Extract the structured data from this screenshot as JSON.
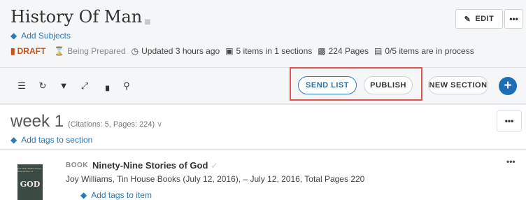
{
  "header": {
    "title": "History Of Man",
    "edit_label": "EDIT",
    "more_label": "•••",
    "add_subjects": "Add Subjects",
    "status": {
      "draft": "DRAFT",
      "prepared": "Being Prepared",
      "updated": "Updated 3 hours ago",
      "items_sections": "5 items in 1 sections",
      "pages": "224 Pages",
      "in_process": "0/5 items are in process"
    }
  },
  "toolbar": {
    "send_list": "SEND LIST",
    "publish": "PUBLISH",
    "new_section": "NEW SECTION",
    "add_label": "+"
  },
  "section": {
    "name": "week 1",
    "meta": "(Citations: 5, Pages: 224)",
    "add_tags": "Add tags to section",
    "more_label": "•••"
  },
  "item": {
    "type": "BOOK",
    "title": "Ninety-Nine Stories of God",
    "details": "Joy Williams, Tin House Books (July 12, 2016), – July 12, 2016, Total Pages 220",
    "add_tags": "Add tags to item",
    "more_label": "•••",
    "cover_top": "JOY WILLIAMS ninety-nine stories of",
    "cover_main": "GOD"
  },
  "colors": {
    "accent": "#2a7ab8",
    "draft": "#c8501a",
    "primary_button": "#1d6eb5",
    "highlight": "#d9534f"
  }
}
